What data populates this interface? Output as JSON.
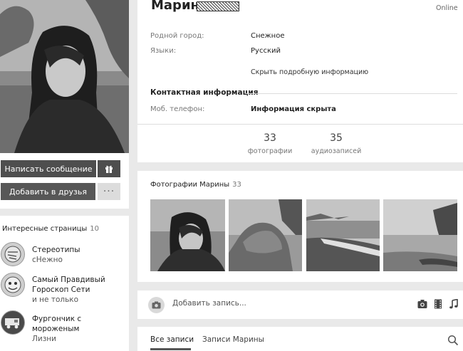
{
  "profile": {
    "name": "Марина",
    "status": "Online"
  },
  "actions": {
    "write_message": "Написать сообщение",
    "gift_icon": "gift-icon",
    "add_friend": "Добавить в друзья",
    "more": "···"
  },
  "details": {
    "hometown_label": "Родной город:",
    "hometown_value": "Снежное",
    "languages_label": "Языки:",
    "languages_value": "Русский",
    "hide_details": "Скрыть подробную информацию",
    "contacts_title": "Контактная информация",
    "phone_label": "Моб. телефон:",
    "phone_value": "Информация скрыта"
  },
  "stats": {
    "photos_count": "33",
    "photos_label": "фотографии",
    "audio_count": "35",
    "audio_label": "аудиозаписей"
  },
  "photos": {
    "title": "Фотографии Марины",
    "count": "33"
  },
  "interesting": {
    "title": "Интересные страницы",
    "count": "10",
    "items": [
      {
        "line1": "Стереотипы",
        "line2": "сНежно",
        "line3": ""
      },
      {
        "line1": "Самый Правдивый",
        "line2": "Гороскоп Сети",
        "line3": "и не только"
      },
      {
        "line1": "Фургончик с",
        "line2": "мороженым",
        "line3": "Лизни"
      }
    ]
  },
  "post": {
    "placeholder": "Добавить запись..."
  },
  "wall": {
    "tab_all": "Все записи",
    "tab_own": "Записи Марины"
  }
}
